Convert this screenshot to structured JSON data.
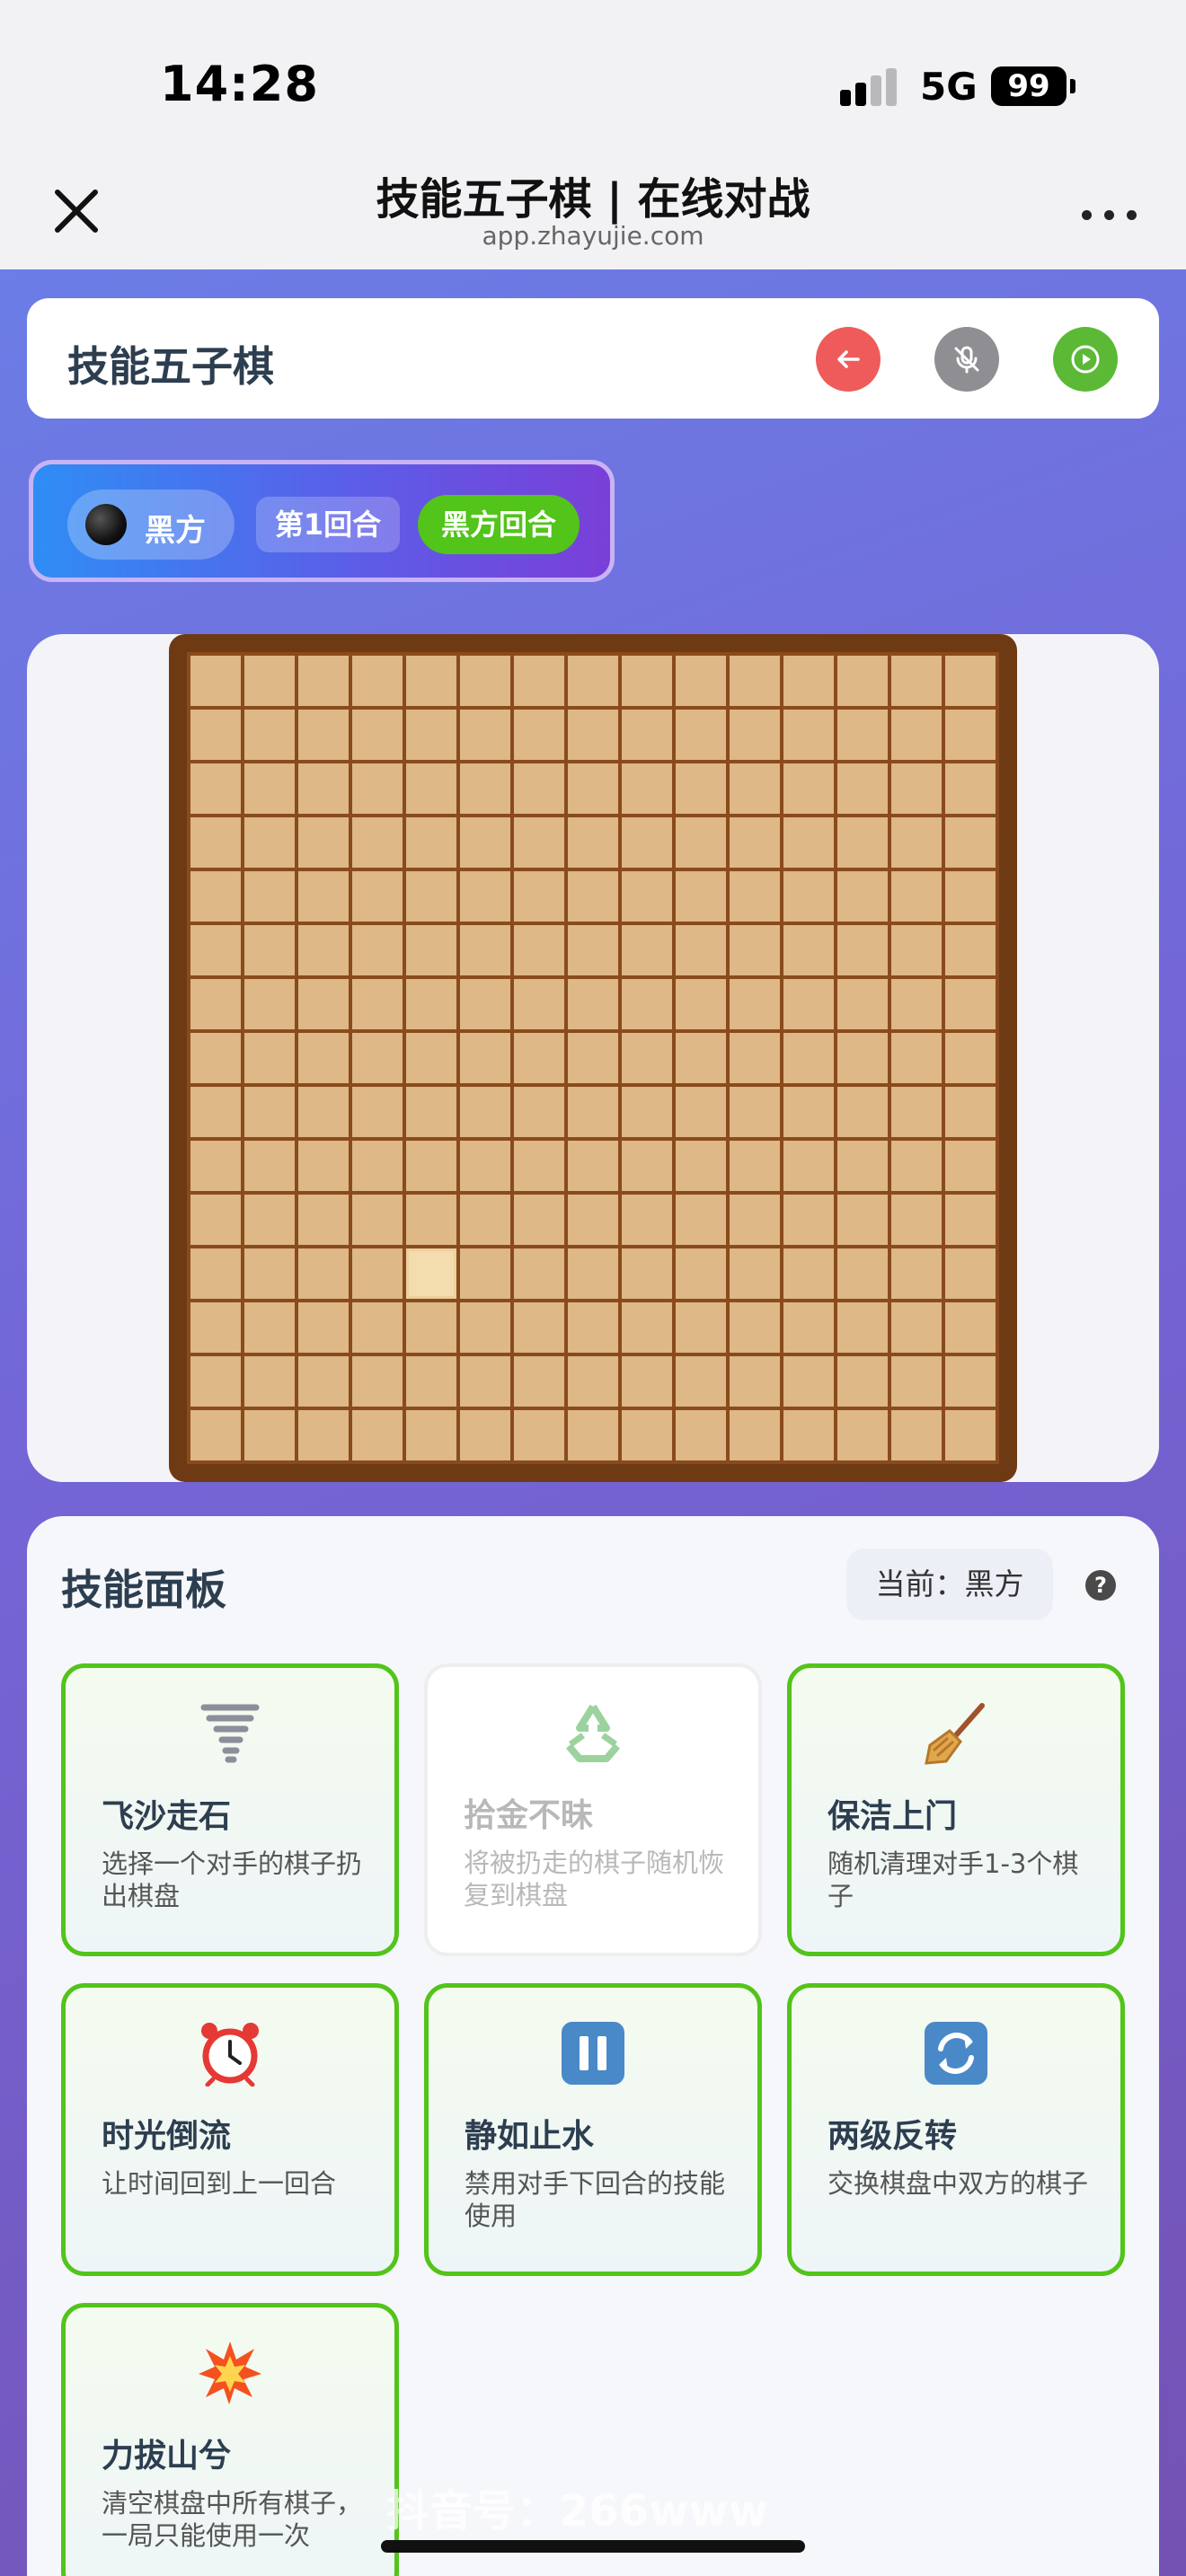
{
  "status_bar": {
    "time": "14:28",
    "network": "5G",
    "battery": "99"
  },
  "browser": {
    "title": "技能五子棋 | 在线对战",
    "url": "app.zhayujie.com",
    "close_icon": "close-icon",
    "more_icon": "more-dots-icon"
  },
  "header": {
    "title": "技能五子棋",
    "buttons": [
      "back-arrow-icon",
      "mic-muted-icon",
      "play-circle-icon"
    ]
  },
  "turn": {
    "player": "黑方",
    "round": "第1回合",
    "status": "黑方回合"
  },
  "board": {
    "size": 15,
    "highlight_cell": {
      "row": 12,
      "col": 5
    }
  },
  "skill_panel": {
    "title": "技能面板",
    "current": "当前：黑方",
    "help": "?",
    "skills": [
      {
        "icon": "tornado-icon",
        "name": "飞沙走石",
        "desc": "选择一个对手的棋子扔出棋盘",
        "enabled": true
      },
      {
        "icon": "recycle-icon",
        "name": "拾金不昧",
        "desc": "将被扔走的棋子随机恢复到棋盘",
        "enabled": false
      },
      {
        "icon": "broom-icon",
        "name": "保洁上门",
        "desc": "随机清理对手1-3个棋子",
        "enabled": true
      },
      {
        "icon": "alarm-clock-icon",
        "name": "时光倒流",
        "desc": "让时间回到上一回合",
        "enabled": true
      },
      {
        "icon": "pause-icon",
        "name": "静如止水",
        "desc": "禁用对手下回合的技能使用",
        "enabled": true
      },
      {
        "icon": "swap-icon",
        "name": "两级反转",
        "desc": "交换棋盘中双方的棋子",
        "enabled": true
      },
      {
        "icon": "explosion-icon",
        "name": "力拔山兮",
        "desc": "清空棋盘中所有棋子，一局只能使用一次",
        "enabled": true
      }
    ]
  },
  "watermark": "抖音号：266www"
}
